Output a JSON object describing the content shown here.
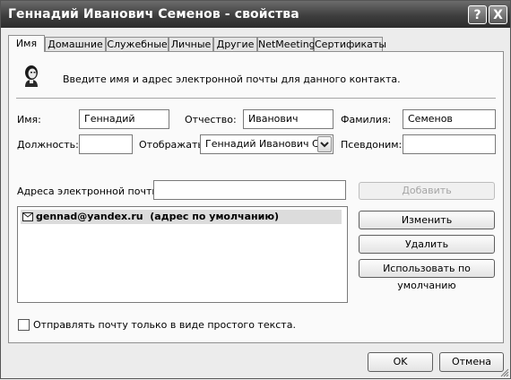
{
  "window": {
    "title": "Геннадий Иванович Семенов - свойства",
    "help_glyph": "?",
    "close_glyph": "X"
  },
  "tabs": [
    {
      "label": "Имя",
      "active": true
    },
    {
      "label": "Домашние"
    },
    {
      "label": "Служебные"
    },
    {
      "label": "Личные"
    },
    {
      "label": "Другие"
    },
    {
      "label": "NetMeeting"
    },
    {
      "label": "Сертификаты"
    }
  ],
  "header": {
    "icon": "contact-person-icon",
    "text": "Введите имя и адрес электронной почты для данного контакта."
  },
  "form": {
    "first_name_label": "Имя:",
    "first_name_value": "Геннадий",
    "middle_name_label": "Отчество:",
    "middle_name_value": "Иванович",
    "last_name_label": "Фамилия:",
    "last_name_value": "Семенов",
    "position_label": "Должность:",
    "position_value": "",
    "display_label": "Отображать:",
    "display_value": "Геннадий Иванович Семенов",
    "nickname_label": "Псевдоним:",
    "nickname_value": ""
  },
  "email": {
    "label": "Адреса электронной почты:",
    "input_value": "",
    "add_button": "Добавить",
    "entries": [
      {
        "address": "gennad@yandex.ru",
        "note": "(адрес по умолчанию)"
      }
    ],
    "edit_button": "Изменить",
    "delete_button": "Удалить",
    "default_button": "Использовать по умолчанию"
  },
  "plain_text": {
    "label": "Отправлять почту только в виде простого текста.",
    "checked": false
  },
  "footer": {
    "ok": "OK",
    "cancel": "Отмена"
  }
}
